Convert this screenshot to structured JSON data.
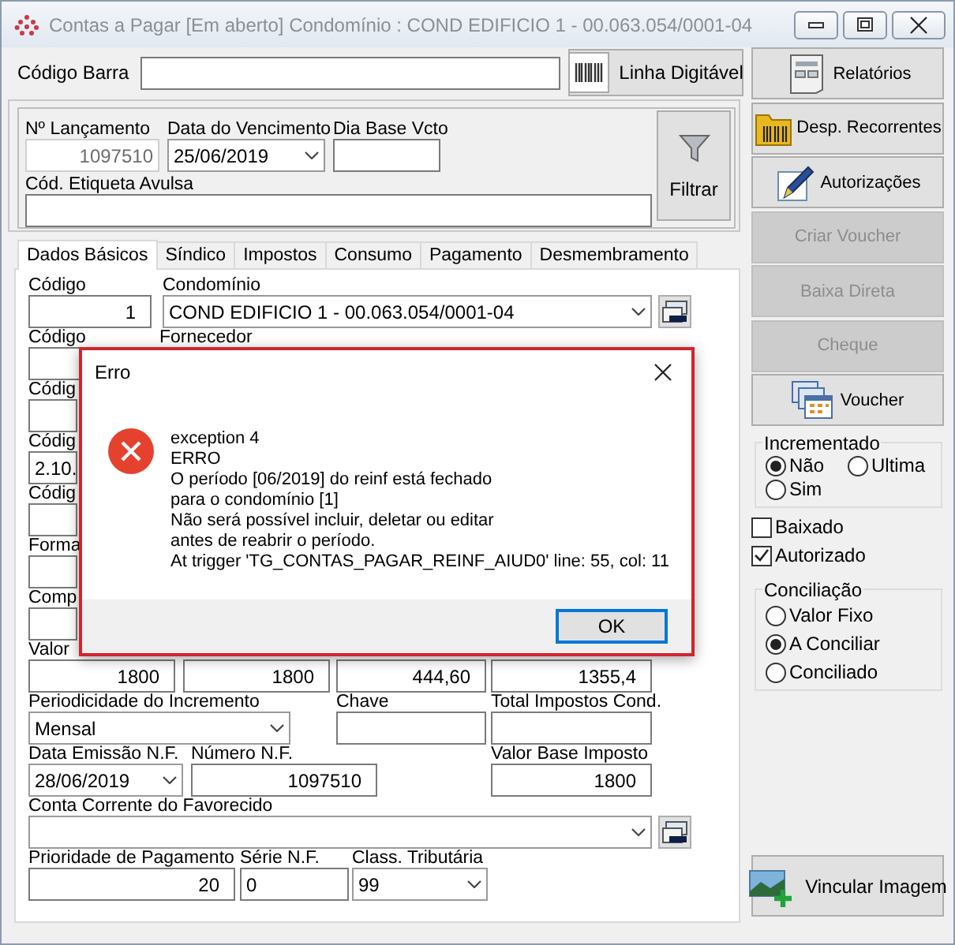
{
  "window": {
    "title": "Contas a Pagar [Em aberto] Condomínio : COND EDIFICIO 1 - 00.063.054/0001-04"
  },
  "barcode": {
    "label": "Código Barra",
    "button": "Linha Digitável"
  },
  "filter": {
    "fields": [
      {
        "label": "Nº Lançamento",
        "value": "1097510",
        "kind": "readonly"
      },
      {
        "label": "Data do Vencimento",
        "value": "25/06/2019",
        "kind": "combo"
      },
      {
        "label": "Dia Base Vcto",
        "kind": "text"
      },
      {
        "label": "Cód. Etiqueta Avulsa",
        "kind": "text"
      }
    ],
    "button": "Filtrar"
  },
  "tabs": [
    {
      "label": "Dados Básicos",
      "selected": true
    },
    {
      "label": "Síndico",
      "selected": false
    },
    {
      "label": "Impostos",
      "selected": false
    },
    {
      "label": "Consumo",
      "selected": false
    },
    {
      "label": "Pagamento",
      "selected": false
    },
    {
      "label": "Desmembramento",
      "selected": false
    }
  ],
  "form": {
    "rows": [
      [
        {
          "label": "Código",
          "value": "1",
          "kind": "number"
        },
        {
          "label": "Condomínio",
          "value": "COND EDIFICIO 1 - 00.063.054/0001-04",
          "kind": "picker"
        }
      ],
      [
        {
          "label": "Código",
          "kind": "text"
        },
        {
          "label": "Fornecedor",
          "kind": "covered"
        }
      ],
      [
        {
          "label": "Códig",
          "kind": "text"
        }
      ],
      [
        {
          "label": "Códig",
          "value": "2.10.",
          "kind": "text"
        }
      ],
      [
        {
          "label": "Códig",
          "kind": "text"
        }
      ],
      [
        {
          "label": "Forma",
          "kind": "text"
        }
      ],
      [
        {
          "label": "Comp",
          "kind": "text"
        }
      ],
      [
        {
          "label": "Valor",
          "value": "1800",
          "kind": "number"
        },
        {
          "value": "1800",
          "kind": "number"
        },
        {
          "value": "444,60",
          "kind": "number"
        },
        {
          "value": "1355,4",
          "kind": "number"
        }
      ],
      [
        {
          "label": "Periodicidade do Incremento",
          "value": "Mensal",
          "kind": "combo"
        },
        {
          "label": "Chave",
          "kind": "text"
        },
        {
          "label": "Total Impostos Cond.",
          "kind": "text"
        }
      ],
      [
        {
          "label": "Data Emissão N.F.",
          "value": "28/06/2019",
          "kind": "combo"
        },
        {
          "label": "Número N.F.",
          "value": "1097510",
          "kind": "number"
        },
        {
          "label": "Valor Base Imposto",
          "value": "1800",
          "kind": "number"
        }
      ],
      [
        {
          "label": "Conta Corrente do Favorecido",
          "kind": "picker"
        }
      ],
      [
        {
          "label": "Prioridade de Pagamento",
          "value": "20",
          "kind": "number"
        },
        {
          "label": "Série N.F.",
          "value": "0",
          "kind": "text"
        },
        {
          "label": "Class. Tributária",
          "value": "99",
          "kind": "combo"
        }
      ]
    ]
  },
  "side_buttons": [
    {
      "label": "Relatórios",
      "disabled": false
    },
    {
      "label": "Desp. Recorrentes",
      "disabled": false
    },
    {
      "label": "Autorizações",
      "disabled": false
    },
    {
      "label": "Criar Voucher",
      "disabled": true
    },
    {
      "label": "Baixa Direta",
      "disabled": true
    },
    {
      "label": "Cheque",
      "disabled": true
    },
    {
      "label": "Voucher",
      "disabled": false
    }
  ],
  "incrementado": {
    "title": "Incrementado",
    "options": [
      {
        "label": "Não",
        "selected": true
      },
      {
        "label": "Ultima",
        "selected": false
      },
      {
        "label": "Sim",
        "selected": false
      }
    ]
  },
  "flags": [
    {
      "label": "Baixado",
      "checked": false
    },
    {
      "label": "Autorizado",
      "checked": true
    }
  ],
  "conciliacao": {
    "title": "Conciliação",
    "options": [
      {
        "label": "Valor Fixo",
        "selected": false
      },
      {
        "label": "A Conciliar",
        "selected": true
      },
      {
        "label": "Conciliado",
        "selected": false
      }
    ]
  },
  "attach_button": "Vincular Imagem",
  "dialog": {
    "title": "Erro",
    "lines": [
      "exception 4",
      "ERRO",
      "O período [06/2019] do reinf está fechado",
      "para o condomínio [1]",
      "Não será possível incluir, deletar ou editar",
      "antes de reabrir o período.",
      "At trigger 'TG_CONTAS_PAGAR_REINF_AIUD0' line: 55, col: 11"
    ],
    "button": "OK"
  }
}
